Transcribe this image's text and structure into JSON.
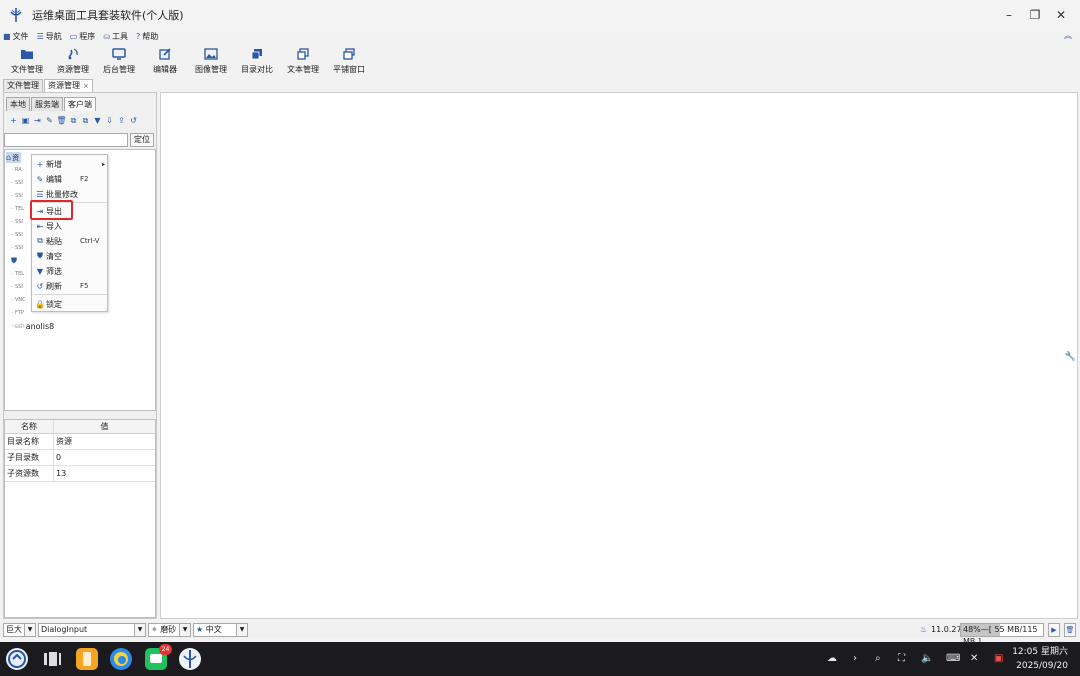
{
  "window": {
    "title": "运维桌面工具套装软件(个人版)",
    "controls": {
      "minimize": "–",
      "restore": "❐",
      "close": "✕"
    }
  },
  "menubar": {
    "items": [
      {
        "label": "文件",
        "icon": "file-icon"
      },
      {
        "label": "导航",
        "icon": "menu-icon"
      },
      {
        "label": "程序",
        "icon": "window-icon"
      },
      {
        "label": "工具",
        "icon": "toolbox-icon"
      },
      {
        "label": "帮助",
        "icon": "help-icon"
      }
    ],
    "collapse_icon": "double-chevron-up-icon"
  },
  "toolbar": {
    "items": [
      {
        "label": "文件管理",
        "icon": "folder-icon"
      },
      {
        "label": "资源管理",
        "icon": "satellite-icon"
      },
      {
        "label": "后台管理",
        "icon": "monitor-icon"
      },
      {
        "label": "编辑器",
        "icon": "edit-icon"
      },
      {
        "label": "图像管理",
        "icon": "image-icon"
      },
      {
        "label": "目录对比",
        "icon": "copy-icon"
      },
      {
        "label": "文本管理",
        "icon": "clone-icon"
      },
      {
        "label": "平铺窗口",
        "icon": "windows-icon"
      }
    ]
  },
  "outer_tabs": [
    {
      "label": "文件管理",
      "active": false
    },
    {
      "label": "资源管理",
      "active": true,
      "close": "×"
    }
  ],
  "inner_tabs": [
    {
      "label": "本地",
      "active": false
    },
    {
      "label": "服务端",
      "active": false
    },
    {
      "label": "客户端",
      "active": true
    }
  ],
  "icon_row": [
    "+",
    "▣",
    "⇥",
    "✎",
    "🗑",
    "⧉",
    "⧉",
    "▼",
    "⇩",
    "⇪",
    "↺"
  ],
  "search": {
    "value": "",
    "locate_label": "定位"
  },
  "tree": {
    "root_label": "资",
    "root_suffix": "源",
    "nodes": [
      "RA",
      "SSI",
      "SSI",
      "TEL",
      "SSI",
      "SSI",
      "SSI",
      "",
      "TEL",
      "SSI",
      "VNC",
      "FTP"
    ],
    "last_node": "anolis8"
  },
  "context_menu": {
    "items": [
      {
        "label": "新增",
        "icon": "+",
        "shortcut": "",
        "submenu": "▸"
      },
      {
        "label": "编辑",
        "icon": "✎",
        "shortcut": "F2",
        "submenu": ""
      },
      {
        "label": "批量修改",
        "icon": "☰",
        "shortcut": "",
        "submenu": ""
      },
      {
        "label": "导出",
        "icon": "⇥",
        "shortcut": "",
        "submenu": ""
      },
      {
        "label": "导入",
        "icon": "⇤",
        "shortcut": "",
        "submenu": ""
      },
      {
        "label": "粘贴",
        "icon": "⧉",
        "shortcut": "Ctrl-V",
        "submenu": ""
      },
      {
        "label": "清空",
        "icon": "⛊",
        "shortcut": "",
        "submenu": ""
      },
      {
        "label": "筛选",
        "icon": "▼",
        "shortcut": "",
        "submenu": ""
      },
      {
        "label": "刷新",
        "icon": "↺",
        "shortcut": "F5",
        "submenu": ""
      },
      {
        "label": "锁定",
        "icon": "🔒",
        "shortcut": "",
        "submenu": ""
      }
    ]
  },
  "properties": {
    "header_name": "名称",
    "header_value": "值",
    "rows": [
      {
        "name": "目录名称",
        "value": "资源"
      },
      {
        "name": "子目录数",
        "value": "0"
      },
      {
        "name": "子资源数",
        "value": "13"
      }
    ]
  },
  "statusbar": {
    "font_size": "巨大",
    "font_family": "DialogInput",
    "theme": "磨砂",
    "language": "中文",
    "version": "11.0.27",
    "memory_percent": 48,
    "memory_text": "48%—[ 55 MB/115 MB ]",
    "gc_icon": "play-icon",
    "trash_icon": "trash-icon"
  },
  "taskbar": {
    "badge_count": "24",
    "clock_time": "12:05 星期六",
    "clock_date": "2025/09/20"
  },
  "colors": {
    "accent": "#2a57a6",
    "highlight": "#e0262d",
    "selection": "#c6d7ef"
  }
}
